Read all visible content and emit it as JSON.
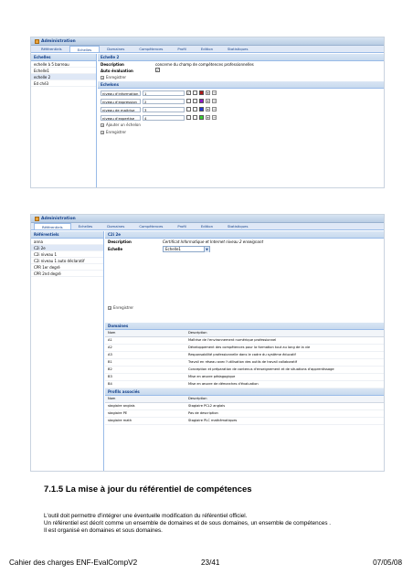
{
  "shot1": {
    "title": "Administration",
    "tabs": [
      "Référentiels",
      "Echelles",
      "Domaines",
      "Compétences",
      "Profil",
      "Edition",
      "Statistiques"
    ],
    "active_tab": 1,
    "left_header": "Echelles",
    "left_items": [
      "echelle à 5 barreau",
      "Echelle1",
      "echelle 2",
      "Ed ché3"
    ],
    "selected_item": 2,
    "right_header": "Echelle 2",
    "desc_label": "Description",
    "desc_value": "concerne du champ de compétences professionnelles",
    "auto_label": "Auto évaluation",
    "save_label": "Enregistrer",
    "levels_header": "Echelons",
    "levels": [
      {
        "name": "niveau d'information",
        "num": "1",
        "color": "#b01818"
      },
      {
        "name": "niveau d'expression",
        "num": "2",
        "color": "#9018c8"
      },
      {
        "name": "niveau de maitrise",
        "num": "3",
        "color": "#2438d8"
      },
      {
        "name": "niveau d'expertise",
        "num": "4",
        "color": "#38d030"
      }
    ],
    "add_level": "Ajouter un échelon",
    "save_label2": "Enregistrer"
  },
  "shot2": {
    "title": "Administration",
    "tabs": [
      "Référentiels",
      "Echelles",
      "Domaines",
      "Compétences",
      "Profil",
      "Edition",
      "Statistiques"
    ],
    "active_tab": 0,
    "left_header": "Référentiels",
    "left_items": [
      "anna",
      "C2i 2e",
      "C2i niveau 1",
      "C2i niveau 1 auto déclaratif",
      "CPR 1er degré",
      "CPR 2nd degré"
    ],
    "selected_item": 1,
    "right_header": "C2i 2e",
    "desc_label": "Description",
    "desc_value": "Certificat Informatique et Internet niveau 2 enseignant",
    "scale_label": "Echelle",
    "scale_value": "Echelle1",
    "save_label": "Enregistrer",
    "domains_header": "Domaines",
    "col_name": "Nom",
    "col_desc": "Description",
    "domains": [
      [
        "A1",
        "Maîtrise de l'environnement numérique professionnel"
      ],
      [
        "A2",
        "Développement des compétences pour la formation tout au long de la vie"
      ],
      [
        "A3",
        "Responsabilité professionnelle dans le cadre du système éducatif"
      ],
      [
        "B1",
        "Travail en réseau avec l'utilisation des outils de travail collaboratif"
      ],
      [
        "B2",
        "Conception et préparation de contenus d'enseignement et de situations d'apprentissage"
      ],
      [
        "B3",
        "Mise en œuvre pédagogique"
      ],
      [
        "B4",
        "Mise en œuvre de démarches d'évaluation"
      ]
    ],
    "profiles_header": "Profils associés",
    "profiles": [
      [
        "stagiaire anglais",
        "Stagiaire PCL2 anglais"
      ],
      [
        "stagiaire PE",
        "Pas de description"
      ],
      [
        "stagiaire math",
        "Stagiaire PLC mathématiques"
      ]
    ]
  },
  "heading": "7.1.5 La mise à jour du référentiel de compétences",
  "paragraph": [
    "L'outil doit permettre d'intégrer une éventuelle modification du référentiel officiel.",
    "Un référentiel est décrit comme un ensemble de domaines et de sous domaines, un ensemble de compétences .",
    "Il est organisé en domaines et sous domaines."
  ],
  "footer": {
    "left": "Cahier des charges ENF-EvalCompV2",
    "middle": "23/41",
    "right": "07/05/08"
  }
}
